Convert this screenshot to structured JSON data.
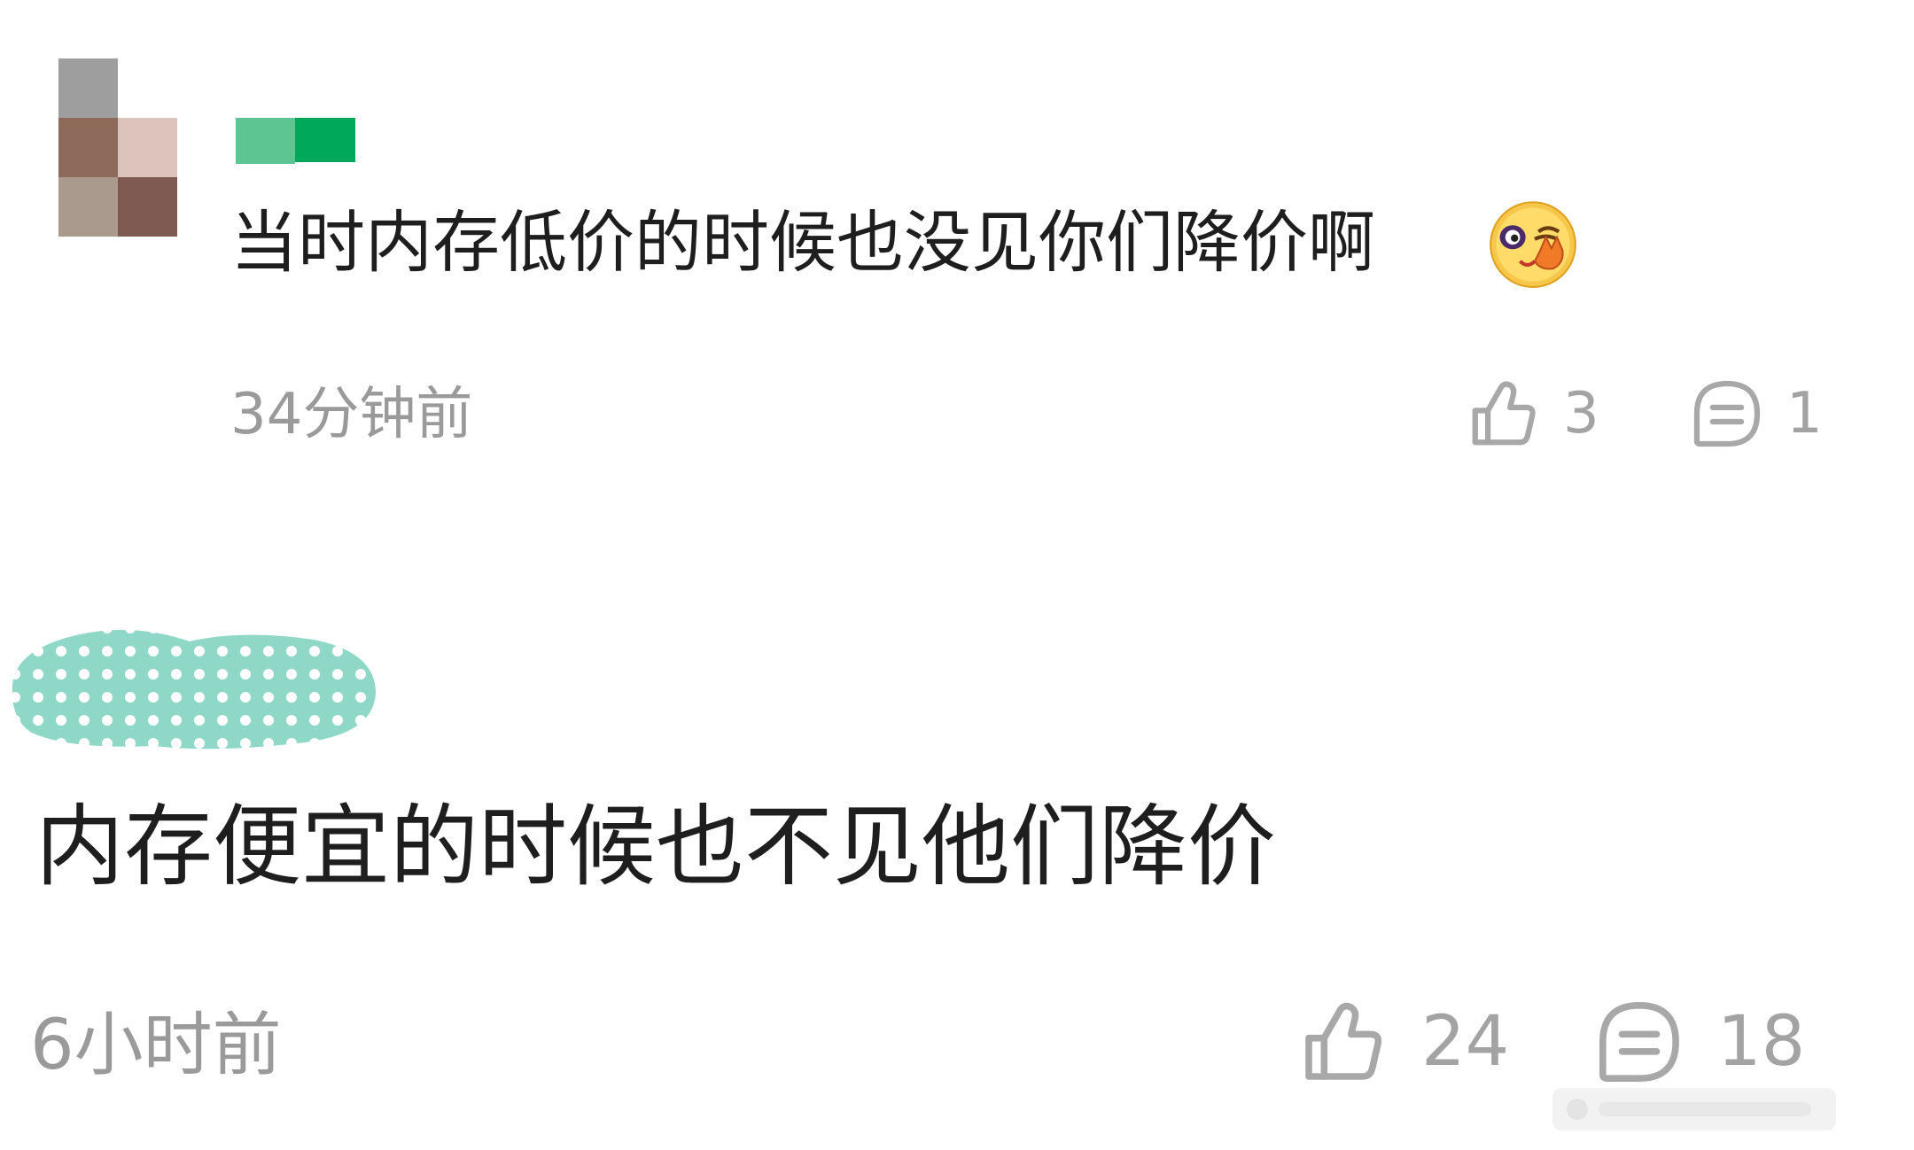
{
  "comments": [
    {
      "username": "",
      "text": "当时内存低价的时候也没见你们降价啊",
      "emoji_icon": "facepalm-emoji-icon",
      "time": "34分钟前",
      "likes": "3",
      "replies": "1"
    },
    {
      "username": "",
      "text": "内存便宜的时候也不见他们降价",
      "time": "6小时前",
      "likes": "24",
      "replies": "18"
    }
  ],
  "icons": {
    "like": "thumbs-up-icon",
    "reply": "comment-bubble-icon"
  },
  "colors": {
    "text": "#1e1e1e",
    "meta": "#9a9a9a",
    "icon": "#a8a8a8",
    "name_redaction_green": "#00a85a",
    "name_redaction_teal": "#8fd8c8"
  }
}
